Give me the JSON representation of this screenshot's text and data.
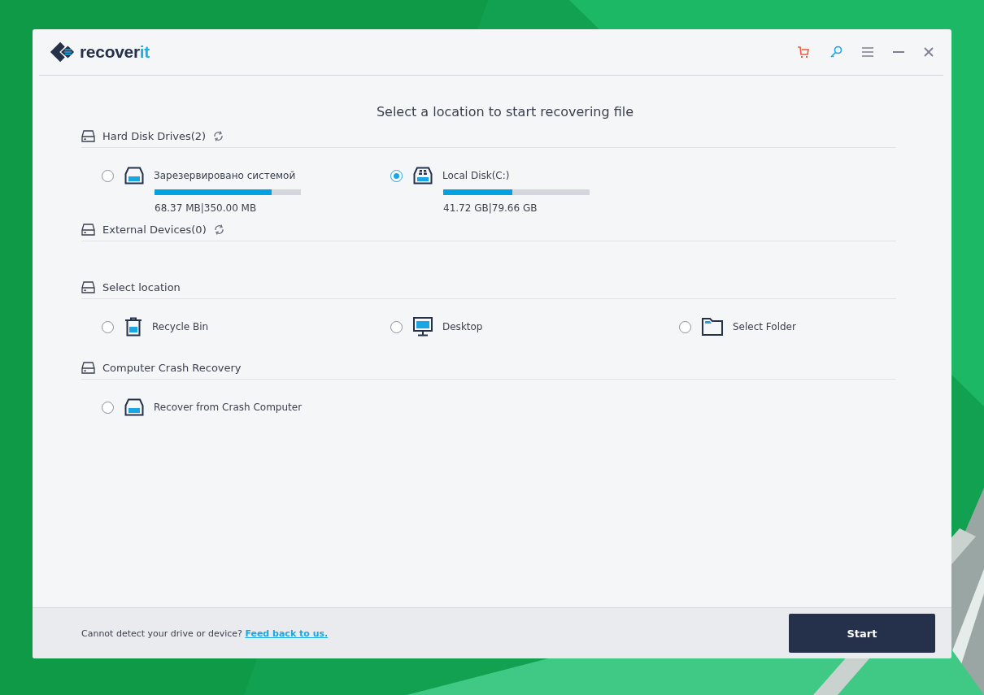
{
  "app": {
    "logo": [
      "recover",
      "it"
    ]
  },
  "heading": "Select a location to start recovering file",
  "sections": [
    {
      "title": "Hard Disk Drives(2)",
      "refresh": true,
      "items": [
        {
          "kind": "drive",
          "label": "Зарезервировано системой",
          "selected": false,
          "level": 0.8,
          "usage": "68.37  MB|350.00  MB"
        },
        {
          "kind": "system_drive",
          "label": "Local Disk(C:)",
          "selected": true,
          "level": 0.47,
          "usage": "41.72  GB|79.66  GB"
        }
      ]
    },
    {
      "title": "External Devices(0)",
      "refresh": true
    },
    {
      "title": "Select location",
      "refresh": false,
      "items": [
        {
          "kind": "recycle_bin",
          "label": "Recycle Bin",
          "selected": false
        },
        {
          "kind": "desktop",
          "label": "Desktop",
          "selected": false
        },
        {
          "kind": "folder",
          "label": "Select Folder",
          "selected": false
        }
      ]
    },
    {
      "title": "Computer Crash Recovery",
      "refresh": false,
      "items": [
        {
          "kind": "drive",
          "label": "Recover from Crash Computer",
          "selected": false
        }
      ]
    }
  ],
  "footer": {
    "message": "Cannot detect your drive or device?",
    "link": "Feed back to us.",
    "button": "Start"
  }
}
